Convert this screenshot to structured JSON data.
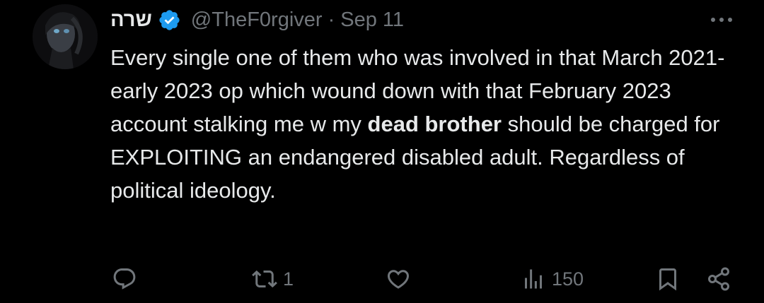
{
  "tweet": {
    "display_name": "שרה",
    "handle": "@TheF0rgiver",
    "separator": "·",
    "date": "Sep 11",
    "text_parts": {
      "p1": "Every single one of them who was involved in that March 2021-early 2023 op which wound down with that February 2023 account stalking me w my ",
      "bold1": "dead brother",
      "p2": " should be charged for EXPLOITING an endangered disabled adult. Regardless of political ideology."
    },
    "actions": {
      "reply_count": "",
      "retweet_count": "1",
      "like_count": "",
      "views_count": "150"
    }
  },
  "icons": {
    "avatar": "avatar-photo",
    "verified": "verified-badge-icon",
    "more": "more-options-icon",
    "reply": "reply-icon",
    "retweet": "retweet-icon",
    "like": "heart-icon",
    "views": "views-icon",
    "bookmark": "bookmark-icon",
    "share": "share-icon"
  },
  "colors": {
    "background": "#000000",
    "text": "#e7e9ea",
    "secondary": "#71767b",
    "verified": "#1d9bf0"
  }
}
